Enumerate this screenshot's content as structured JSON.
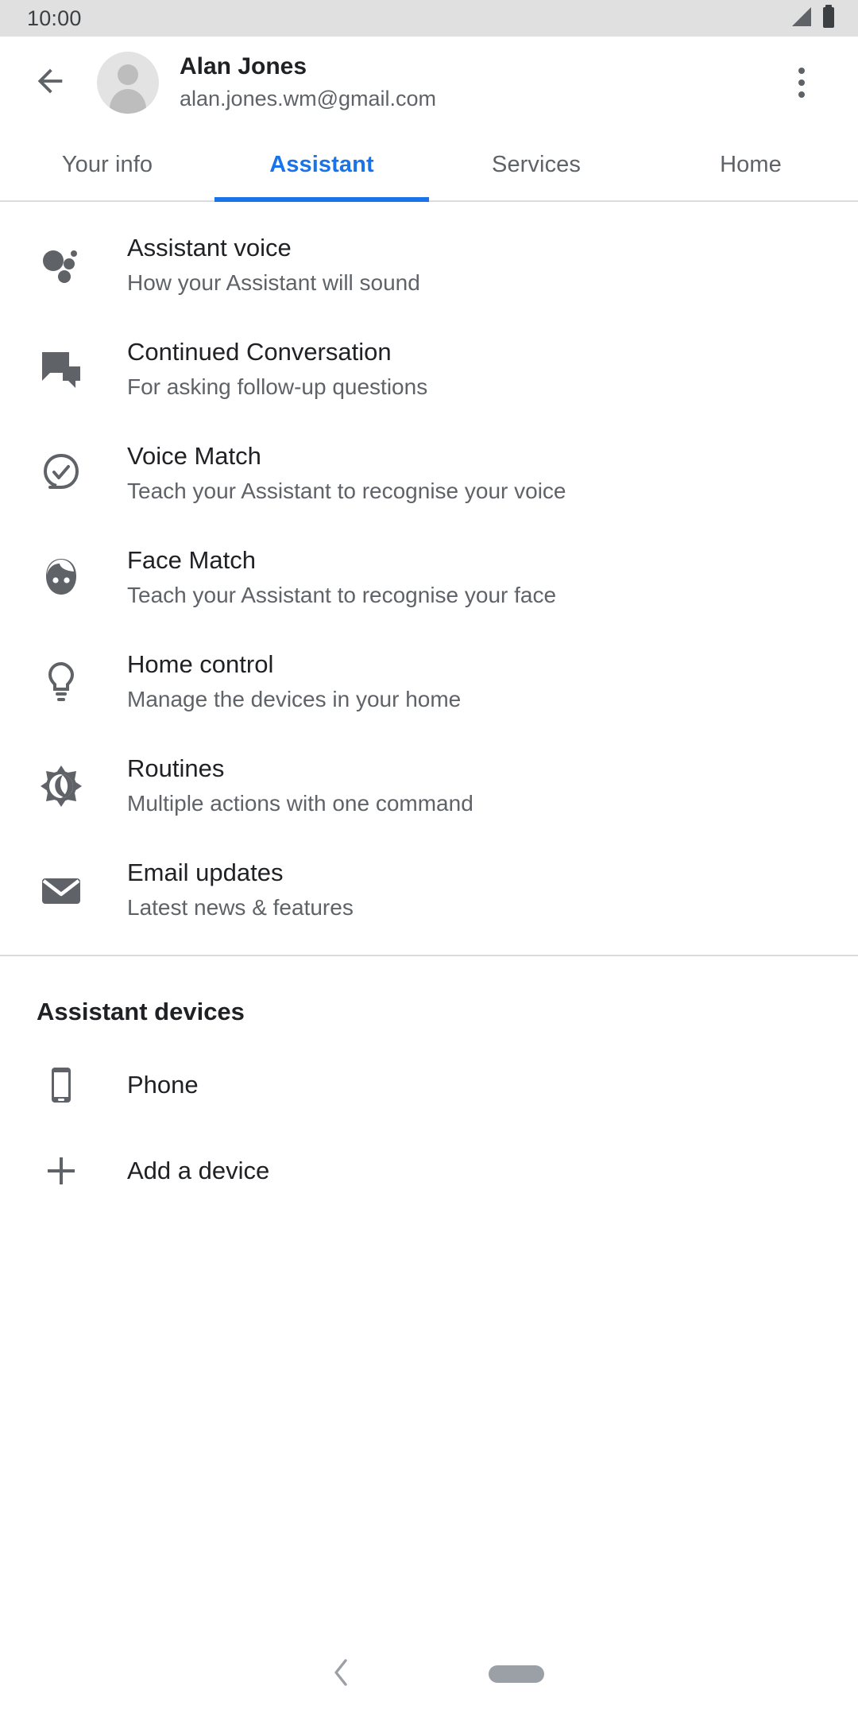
{
  "status_bar": {
    "time": "10:00",
    "signal_icon": "signal-cellular-icon",
    "battery_icon": "battery-full-icon"
  },
  "header": {
    "back_icon": "back-arrow-icon",
    "avatar_icon": "account-avatar-icon",
    "account_name": "Alan Jones",
    "account_email": "alan.jones.wm@gmail.com",
    "overflow_icon": "more-vert-icon"
  },
  "tabs": [
    {
      "label": "Your info",
      "active": false
    },
    {
      "label": "Assistant",
      "active": true
    },
    {
      "label": "Services",
      "active": false
    },
    {
      "label": "Home",
      "active": false
    }
  ],
  "settings": [
    {
      "icon": "assistant-dots-icon",
      "title": "Assistant voice",
      "subtitle": "How your Assistant will sound"
    },
    {
      "icon": "chat-bubbles-icon",
      "title": "Continued Conversation",
      "subtitle": "For asking follow-up questions"
    },
    {
      "icon": "voice-check-circle-icon",
      "title": "Voice Match",
      "subtitle": "Teach your Assistant to recognise your voice"
    },
    {
      "icon": "face-icon",
      "title": "Face Match",
      "subtitle": "Teach your Assistant to recognise your face"
    },
    {
      "icon": "lightbulb-icon",
      "title": "Home control",
      "subtitle": "Manage the devices in your home"
    },
    {
      "icon": "sun-moon-routines-icon",
      "title": "Routines",
      "subtitle": "Multiple actions with one command"
    },
    {
      "icon": "envelope-icon",
      "title": "Email updates",
      "subtitle": "Latest news & features"
    }
  ],
  "devices_section": {
    "title": "Assistant devices",
    "items": [
      {
        "icon": "smartphone-icon",
        "label": "Phone"
      },
      {
        "icon": "plus-icon",
        "label": "Add a device"
      }
    ]
  },
  "nav_bar": {
    "back_icon": "nav-back-chevron-icon",
    "home_pill_icon": "nav-home-pill-icon"
  },
  "colors": {
    "accent": "#1a73e8",
    "status_bar_bg": "#e0e0e0",
    "primary_text": "#202124",
    "secondary_text": "#5f6368",
    "icon_gray": "#5f6368",
    "divider": "#dadce0"
  }
}
